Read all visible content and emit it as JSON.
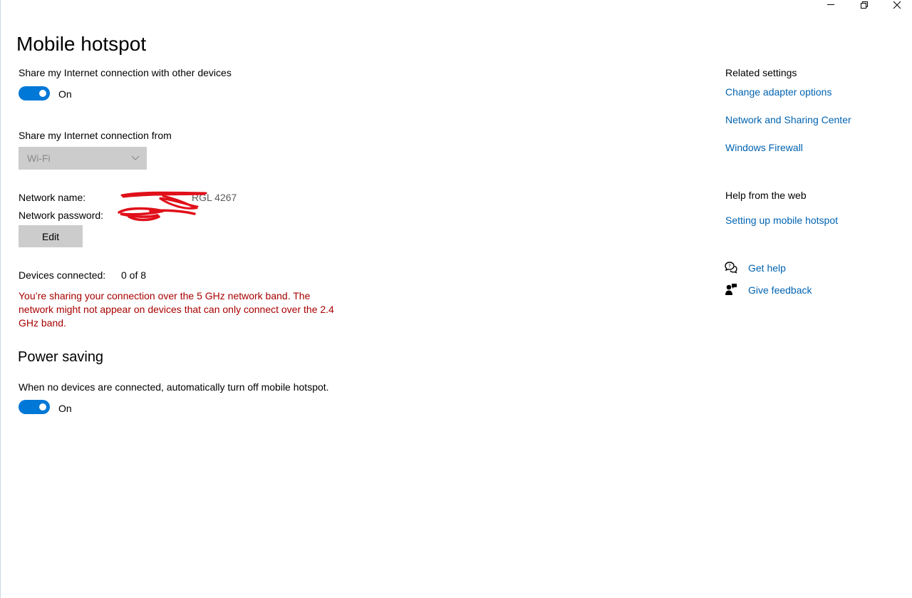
{
  "window": {
    "title": "Mobile hotspot",
    "caption_buttons": [
      "minimize-icon",
      "restore-icon",
      "close-icon"
    ]
  },
  "share": {
    "label": "Share my Internet connection with other devices",
    "toggle_state": "On",
    "toggle_on": true
  },
  "share_from": {
    "label": "Share my Internet connection from",
    "selected": "Wi-Fi"
  },
  "network": {
    "name_label": "Network name:",
    "name_value_visible": "RGL 4267",
    "password_label": "Network password:",
    "edit_label": "Edit"
  },
  "devices": {
    "label": "Devices connected:",
    "value": "0 of 8"
  },
  "warning": "You’re sharing your connection over the 5 GHz network band. The network might not appear on devices that can only connect over the 2.4 GHz band.",
  "power_saving": {
    "title": "Power saving",
    "label": "When no devices are connected, automatically turn off mobile hotspot.",
    "toggle_state": "On",
    "toggle_on": true
  },
  "related": {
    "heading": "Related settings",
    "links": [
      "Change adapter options",
      "Network and Sharing Center",
      "Windows Firewall"
    ]
  },
  "help": {
    "heading": "Help from the web",
    "link": "Setting up mobile hotspot"
  },
  "support": {
    "get_help": "Get help",
    "give_feedback": "Give feedback"
  },
  "colors": {
    "accent": "#0078d7",
    "link": "#0063b1",
    "warning": "#a80000",
    "redaction": "#e0101a"
  }
}
